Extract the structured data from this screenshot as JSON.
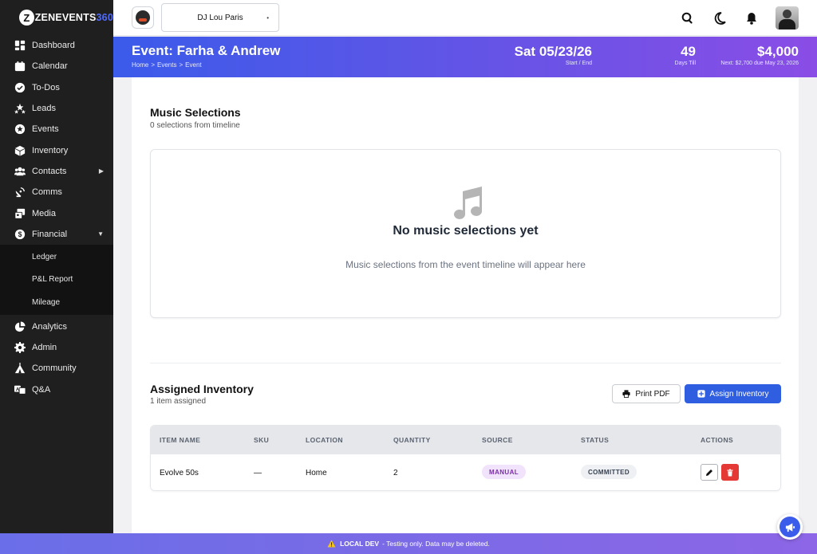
{
  "app": {
    "logo_mark": "Z",
    "logo_text": "ZENEVENTS",
    "logo_num": "360"
  },
  "sidebar": {
    "items": [
      {
        "label": "Dashboard",
        "icon": "dashboard-icon"
      },
      {
        "label": "Calendar",
        "icon": "calendar-icon"
      },
      {
        "label": "To-Dos",
        "icon": "check-circle-icon"
      },
      {
        "label": "Leads",
        "icon": "stars-icon"
      },
      {
        "label": "Events",
        "icon": "star-circle-icon"
      },
      {
        "label": "Inventory",
        "icon": "box-icon"
      },
      {
        "label": "Contacts",
        "icon": "users-icon",
        "caret": "▶"
      },
      {
        "label": "Comms",
        "icon": "satellite-dish-icon"
      },
      {
        "label": "Media",
        "icon": "photo-video-icon"
      },
      {
        "label": "Financial",
        "icon": "dollar-circle-icon",
        "caret": "▼"
      }
    ],
    "sub_items": [
      {
        "label": "Ledger"
      },
      {
        "label": "P&L Report"
      },
      {
        "label": "Mileage"
      }
    ],
    "items2": [
      {
        "label": "Analytics",
        "icon": "chart-pie-icon"
      },
      {
        "label": "Admin",
        "icon": "gear-icon"
      },
      {
        "label": "Community",
        "icon": "tent-icon"
      },
      {
        "label": "Q&A",
        "icon": "language-icon"
      }
    ]
  },
  "topbar": {
    "business": "DJ Lou Paris",
    "business_dot": "•"
  },
  "event": {
    "title": "Event: Farha & Andrew",
    "breadcrumbs": [
      "Home",
      ">",
      "Events",
      ">",
      "Event"
    ],
    "date": "Sat 05/23/26",
    "date_sub": "Start / End",
    "days": "49",
    "days_sub": "Days Till",
    "amount": "$4,000",
    "amount_sub": "Next: $2,700 due May 23, 2026"
  },
  "music": {
    "title": "Music Selections",
    "subtitle": "0 selections from timeline",
    "empty_title": "No music selections yet",
    "empty_desc": "Music selections from the event timeline will appear here"
  },
  "inventory": {
    "title": "Assigned Inventory",
    "subtitle": "1 item assigned",
    "print_label": "Print PDF",
    "assign_label": "Assign Inventory",
    "columns": [
      "ITEM NAME",
      "SKU",
      "LOCATION",
      "QUANTITY",
      "SOURCE",
      "STATUS",
      "ACTIONS"
    ],
    "rows": [
      {
        "name": "Evolve 50s",
        "sku": "—",
        "location": "Home",
        "quantity": "2",
        "source": "MANUAL",
        "status": "COMMITTED"
      }
    ]
  },
  "footer": {
    "label": "LOCAL DEV",
    "text": "- Testing only. Data may be deleted."
  },
  "colors": {
    "accent": "#2f5ee0",
    "header_start": "#3b5bea",
    "header_end": "#8a4de6",
    "danger": "#e53935"
  }
}
